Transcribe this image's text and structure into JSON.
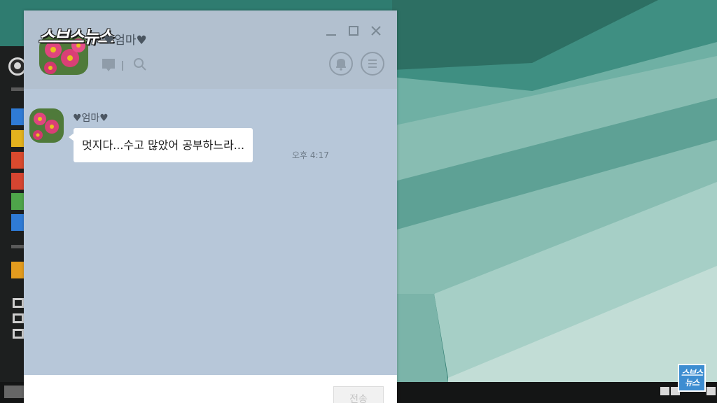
{
  "overlay": {
    "brand_logo": "스브스뉴스",
    "corner_logo": "스브스뉴스"
  },
  "chat": {
    "title": "♥엄마♥",
    "messages": [
      {
        "sender": "♥엄마♥",
        "text": "멋지다...수고 많았어 공부하느라...",
        "time": "오후 4:17"
      }
    ],
    "input": {
      "placeholder": "",
      "value": ""
    },
    "send_label": "전송"
  },
  "icons": {
    "minimize": "minimize-icon",
    "maximize": "maximize-icon",
    "close": "close-icon",
    "profile": "profile-icon",
    "search": "search-icon",
    "bell": "bell-icon",
    "menu": "menu-icon"
  },
  "colors": {
    "chat_bg": "#b7c7d9",
    "header_bg": "#b2c0cf",
    "bubble_bg": "#ffffff",
    "wallpaper": "#2f7c70",
    "side_swatches": [
      "#2f7bd6",
      "#e3b21e",
      "#d94a2e",
      "#d64531",
      "#4ea54a",
      "#2f7bd6",
      "#e39b1e"
    ]
  }
}
